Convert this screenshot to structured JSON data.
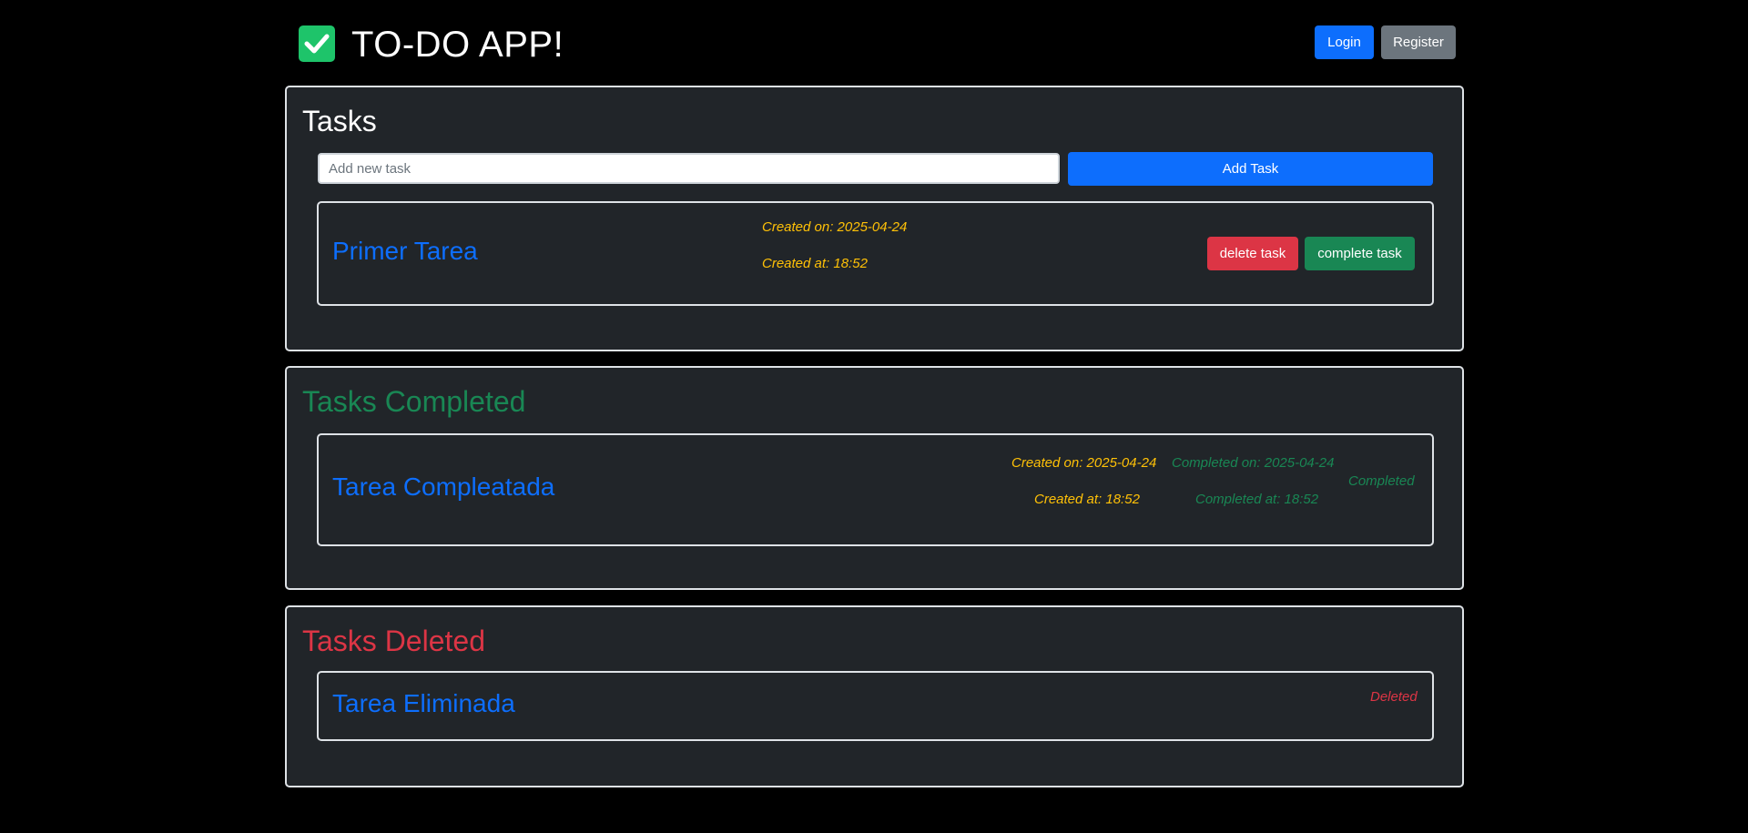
{
  "header": {
    "title": "TO-DO APP!",
    "login_label": "Login",
    "register_label": "Register"
  },
  "tasks_section": {
    "title": "Tasks",
    "input_placeholder": "Add new task",
    "add_button_label": "Add Task",
    "items": [
      {
        "name": "Primer Tarea",
        "created_on": "Created on: 2025-04-24",
        "created_at": "Created at: 18:52",
        "delete_label": "delete task",
        "complete_label": "complete task"
      }
    ]
  },
  "completed_section": {
    "title": "Tasks Completed",
    "items": [
      {
        "name": "Tarea Compleatada",
        "created_on": "Created on: 2025-04-24",
        "created_at": "Created at: 18:52",
        "completed_on": "Completed on: 2025-04-24",
        "completed_at": "Completed at: 18:52",
        "status": "Completed"
      }
    ]
  },
  "deleted_section": {
    "title": "Tasks Deleted",
    "items": [
      {
        "name": "Tarea Eliminada",
        "status": "Deleted"
      }
    ]
  },
  "colors": {
    "background": "#000000",
    "panel": "#212529",
    "primary": "#0d6efd",
    "secondary": "#6c757d",
    "success": "#198754",
    "danger": "#dc3545",
    "warning": "#ffc107",
    "logo_green": "#1ec46a"
  },
  "icons": {
    "logo": "check-square-icon"
  }
}
